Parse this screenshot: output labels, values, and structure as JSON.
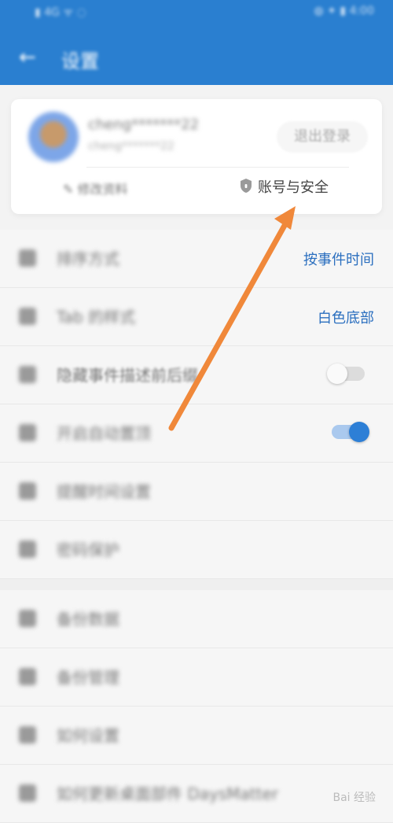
{
  "statusbar": {
    "left_text": "▮ 4G ᯤ ◌",
    "right_text": "◍ ✦ ▮ 4:00"
  },
  "appbar": {
    "back_glyph": "←",
    "title": "设置"
  },
  "account": {
    "username": "cheng*******22",
    "subtext": "cheng*******22",
    "logout_label": "退出登录",
    "edit_label": "✎ 修改资料",
    "security_label": "账号与安全"
  },
  "settings": [
    {
      "label": "排序方式",
      "value": "按事件时间",
      "control": "value"
    },
    {
      "label": "Tab 的样式",
      "value": "白色底部",
      "control": "value"
    },
    {
      "label": "隐藏事件描述前后缀",
      "control": "toggle",
      "on": false
    },
    {
      "label": "开启自动置顶",
      "control": "toggle",
      "on": true
    },
    {
      "label": "提醒时间设置",
      "control": "none"
    },
    {
      "label": "密码保护",
      "control": "none"
    }
  ],
  "settings2": [
    {
      "label": "备份数据"
    },
    {
      "label": "备份管理"
    },
    {
      "label": "如何设置"
    },
    {
      "label": "如何更新桌面部件 DaysMatter"
    }
  ],
  "watermark": "Bai 经验",
  "colors": {
    "appbar": "#2a7fd0",
    "accent_text": "#2b6fbf",
    "arrow": "#f0883a",
    "toggle_on": "#2d7fd6"
  }
}
